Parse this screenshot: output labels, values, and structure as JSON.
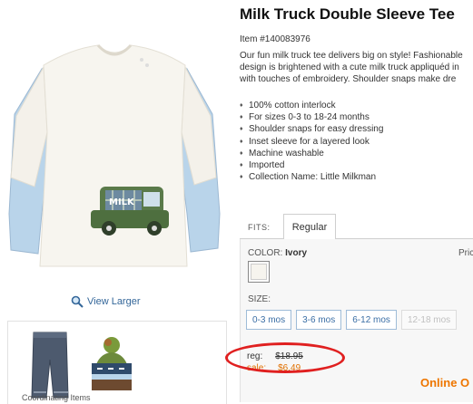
{
  "product": {
    "title": "Milk Truck Double Sleeve Tee",
    "item_number": "Item #140083976",
    "description_lines": [
      "Our fun milk truck tee delivers big on style! Fashionable",
      "design is brightened with a cute milk truck appliquéd in",
      "with touches of embroidery. Shoulder snaps make dre"
    ],
    "features": [
      "100% cotton interlock",
      "For sizes 0-3 to 18-24 months",
      "Shoulder snaps for easy dressing",
      "Inset sleeve for a layered look",
      "Machine washable",
      "Imported",
      "Collection Name: Little Milkman"
    ],
    "applique_text": "MILK"
  },
  "view_larger_label": "View Larger",
  "fits": {
    "label": "FITS:",
    "tabs": [
      "Regular"
    ]
  },
  "options": {
    "color_label": "COLOR:",
    "color_value": "Ivory",
    "price_header": "Pric",
    "size_label": "SIZE:",
    "sizes": [
      {
        "label": "0-3 mos",
        "available": true
      },
      {
        "label": "3-6 mos",
        "available": true
      },
      {
        "label": "6-12 mos",
        "available": true
      },
      {
        "label": "12-18 mos",
        "available": false
      }
    ]
  },
  "pricing": {
    "reg_label": "reg:",
    "reg_value": "$18.95",
    "sale_label": "sale:",
    "sale_value": "$6.49"
  },
  "online_text": "Online O",
  "thumbs_caption": "Coordinating Items",
  "colors": {
    "sale": "#e07000",
    "link": "#3a6ea5",
    "annotation": "#e02020"
  }
}
